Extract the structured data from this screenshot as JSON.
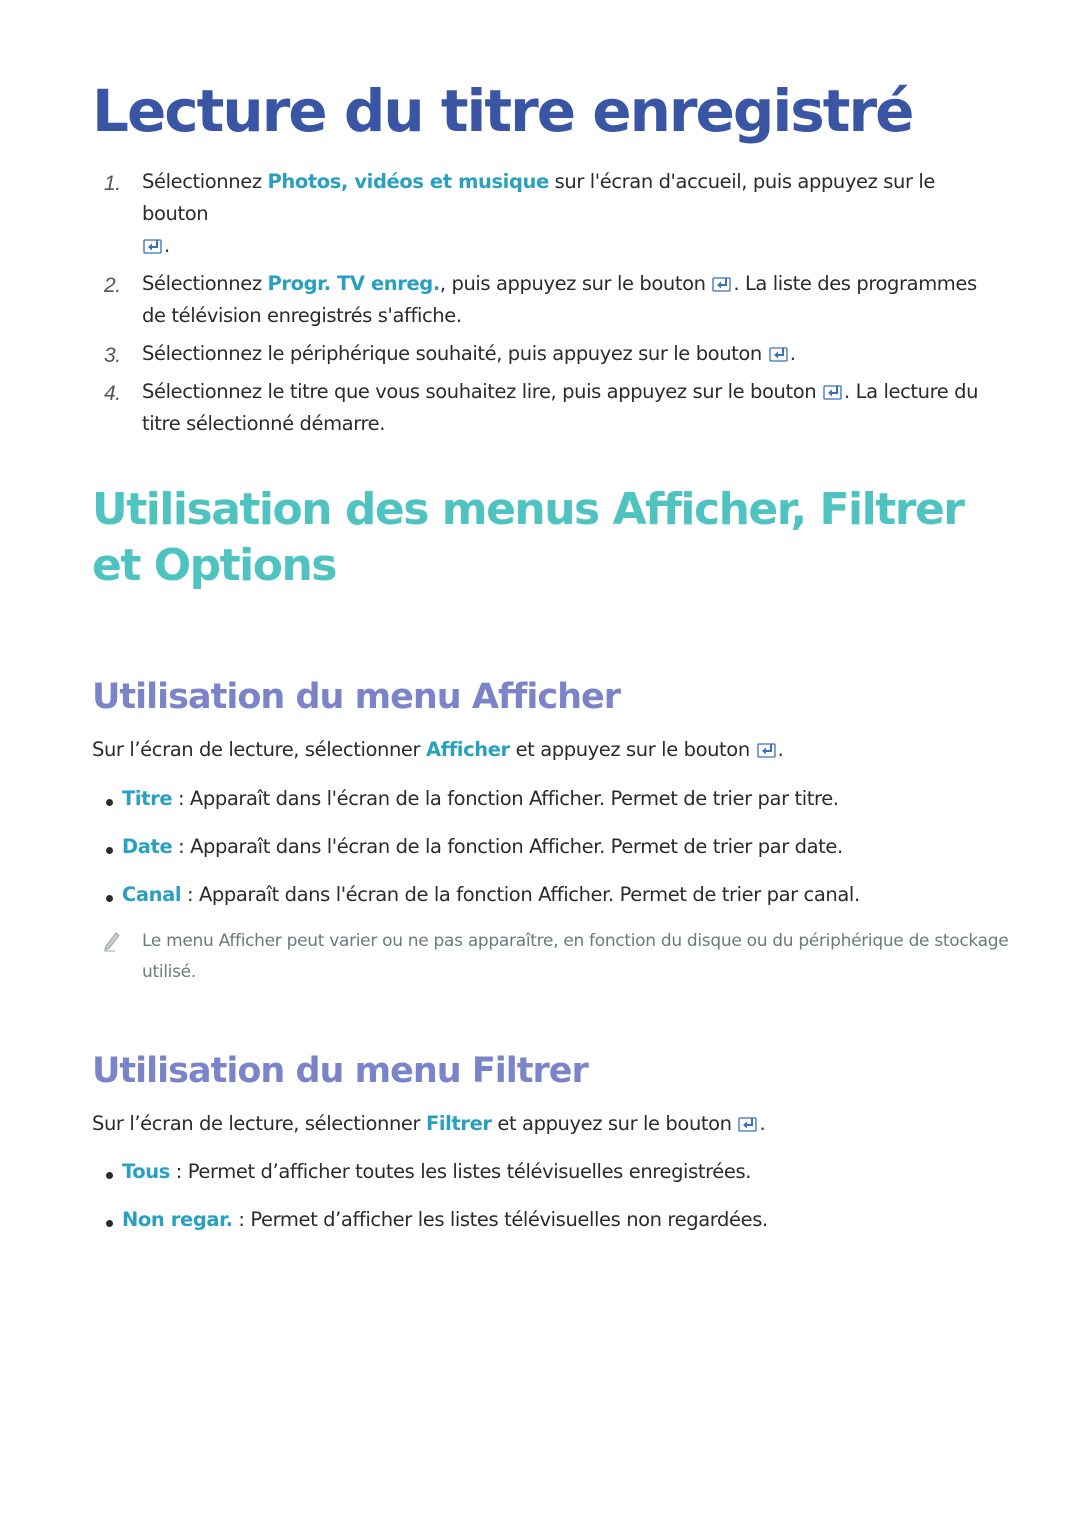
{
  "title": "Lecture du titre enregistré",
  "steps": [
    {
      "num": "1.",
      "pre": "Sélectionnez ",
      "highlight": "Photos, vidéos et musique",
      "post": " sur l'écran d'accueil, puis appuyez sur le bouton ",
      "icon": "enter-icon",
      "after": "."
    },
    {
      "num": "2.",
      "pre": "Sélectionnez ",
      "highlight": "Progr. TV enreg.",
      "post": ", puis appuyez sur le bouton ",
      "icon": "enter-icon",
      "after": ". La liste des programmes de télévision enregistrés s'affiche."
    },
    {
      "num": "3.",
      "pre": "Sélectionnez le périphérique souhaité, puis appuyez sur le bouton ",
      "icon": "enter-icon",
      "after": "."
    },
    {
      "num": "4.",
      "pre": "Sélectionnez le titre que vous souhaitez lire, puis appuyez sur le bouton ",
      "icon": "enter-icon",
      "after": ". La lecture du titre sélectionné démarre."
    }
  ],
  "section_title": "Utilisation des menus Afficher, Filtrer et Options",
  "afficher": {
    "title": "Utilisation du menu Afficher",
    "intro_pre": "Sur l’écran de lecture, sélectionner ",
    "intro_highlight": "Afficher",
    "intro_post": " et appuyez sur le bouton ",
    "intro_after": ".",
    "items": [
      {
        "label": "Titre",
        "text": " : Apparaît dans l'écran de la fonction Afficher. Permet de trier par titre."
      },
      {
        "label": "Date",
        "text": " : Apparaît dans l'écran de la fonction Afficher. Permet de trier par date."
      },
      {
        "label": "Canal",
        "text": " : Apparaît dans l'écran de la fonction Afficher. Permet de trier par canal."
      }
    ],
    "note": "Le menu Afficher peut varier ou ne pas apparaître, en fonction du disque ou du périphérique de stockage utilisé."
  },
  "filtrer": {
    "title": "Utilisation du menu Filtrer",
    "intro_pre": "Sur l’écran de lecture, sélectionner ",
    "intro_highlight": "Filtrer",
    "intro_post": " et appuyez sur le bouton ",
    "intro_after": ".",
    "items": [
      {
        "label": "Tous",
        "text": " : Permet d’afficher toutes les listes télévisuelles enregistrées."
      },
      {
        "label": "Non regar.",
        "text": " : Permet d’afficher les listes télévisuelles non regardées."
      }
    ]
  },
  "colors": {
    "title": "#3a55a4",
    "section": "#4fc3c0",
    "subsection": "#7b84c8",
    "highlight": "#2aa0c0",
    "note": "#6e7a7a"
  }
}
